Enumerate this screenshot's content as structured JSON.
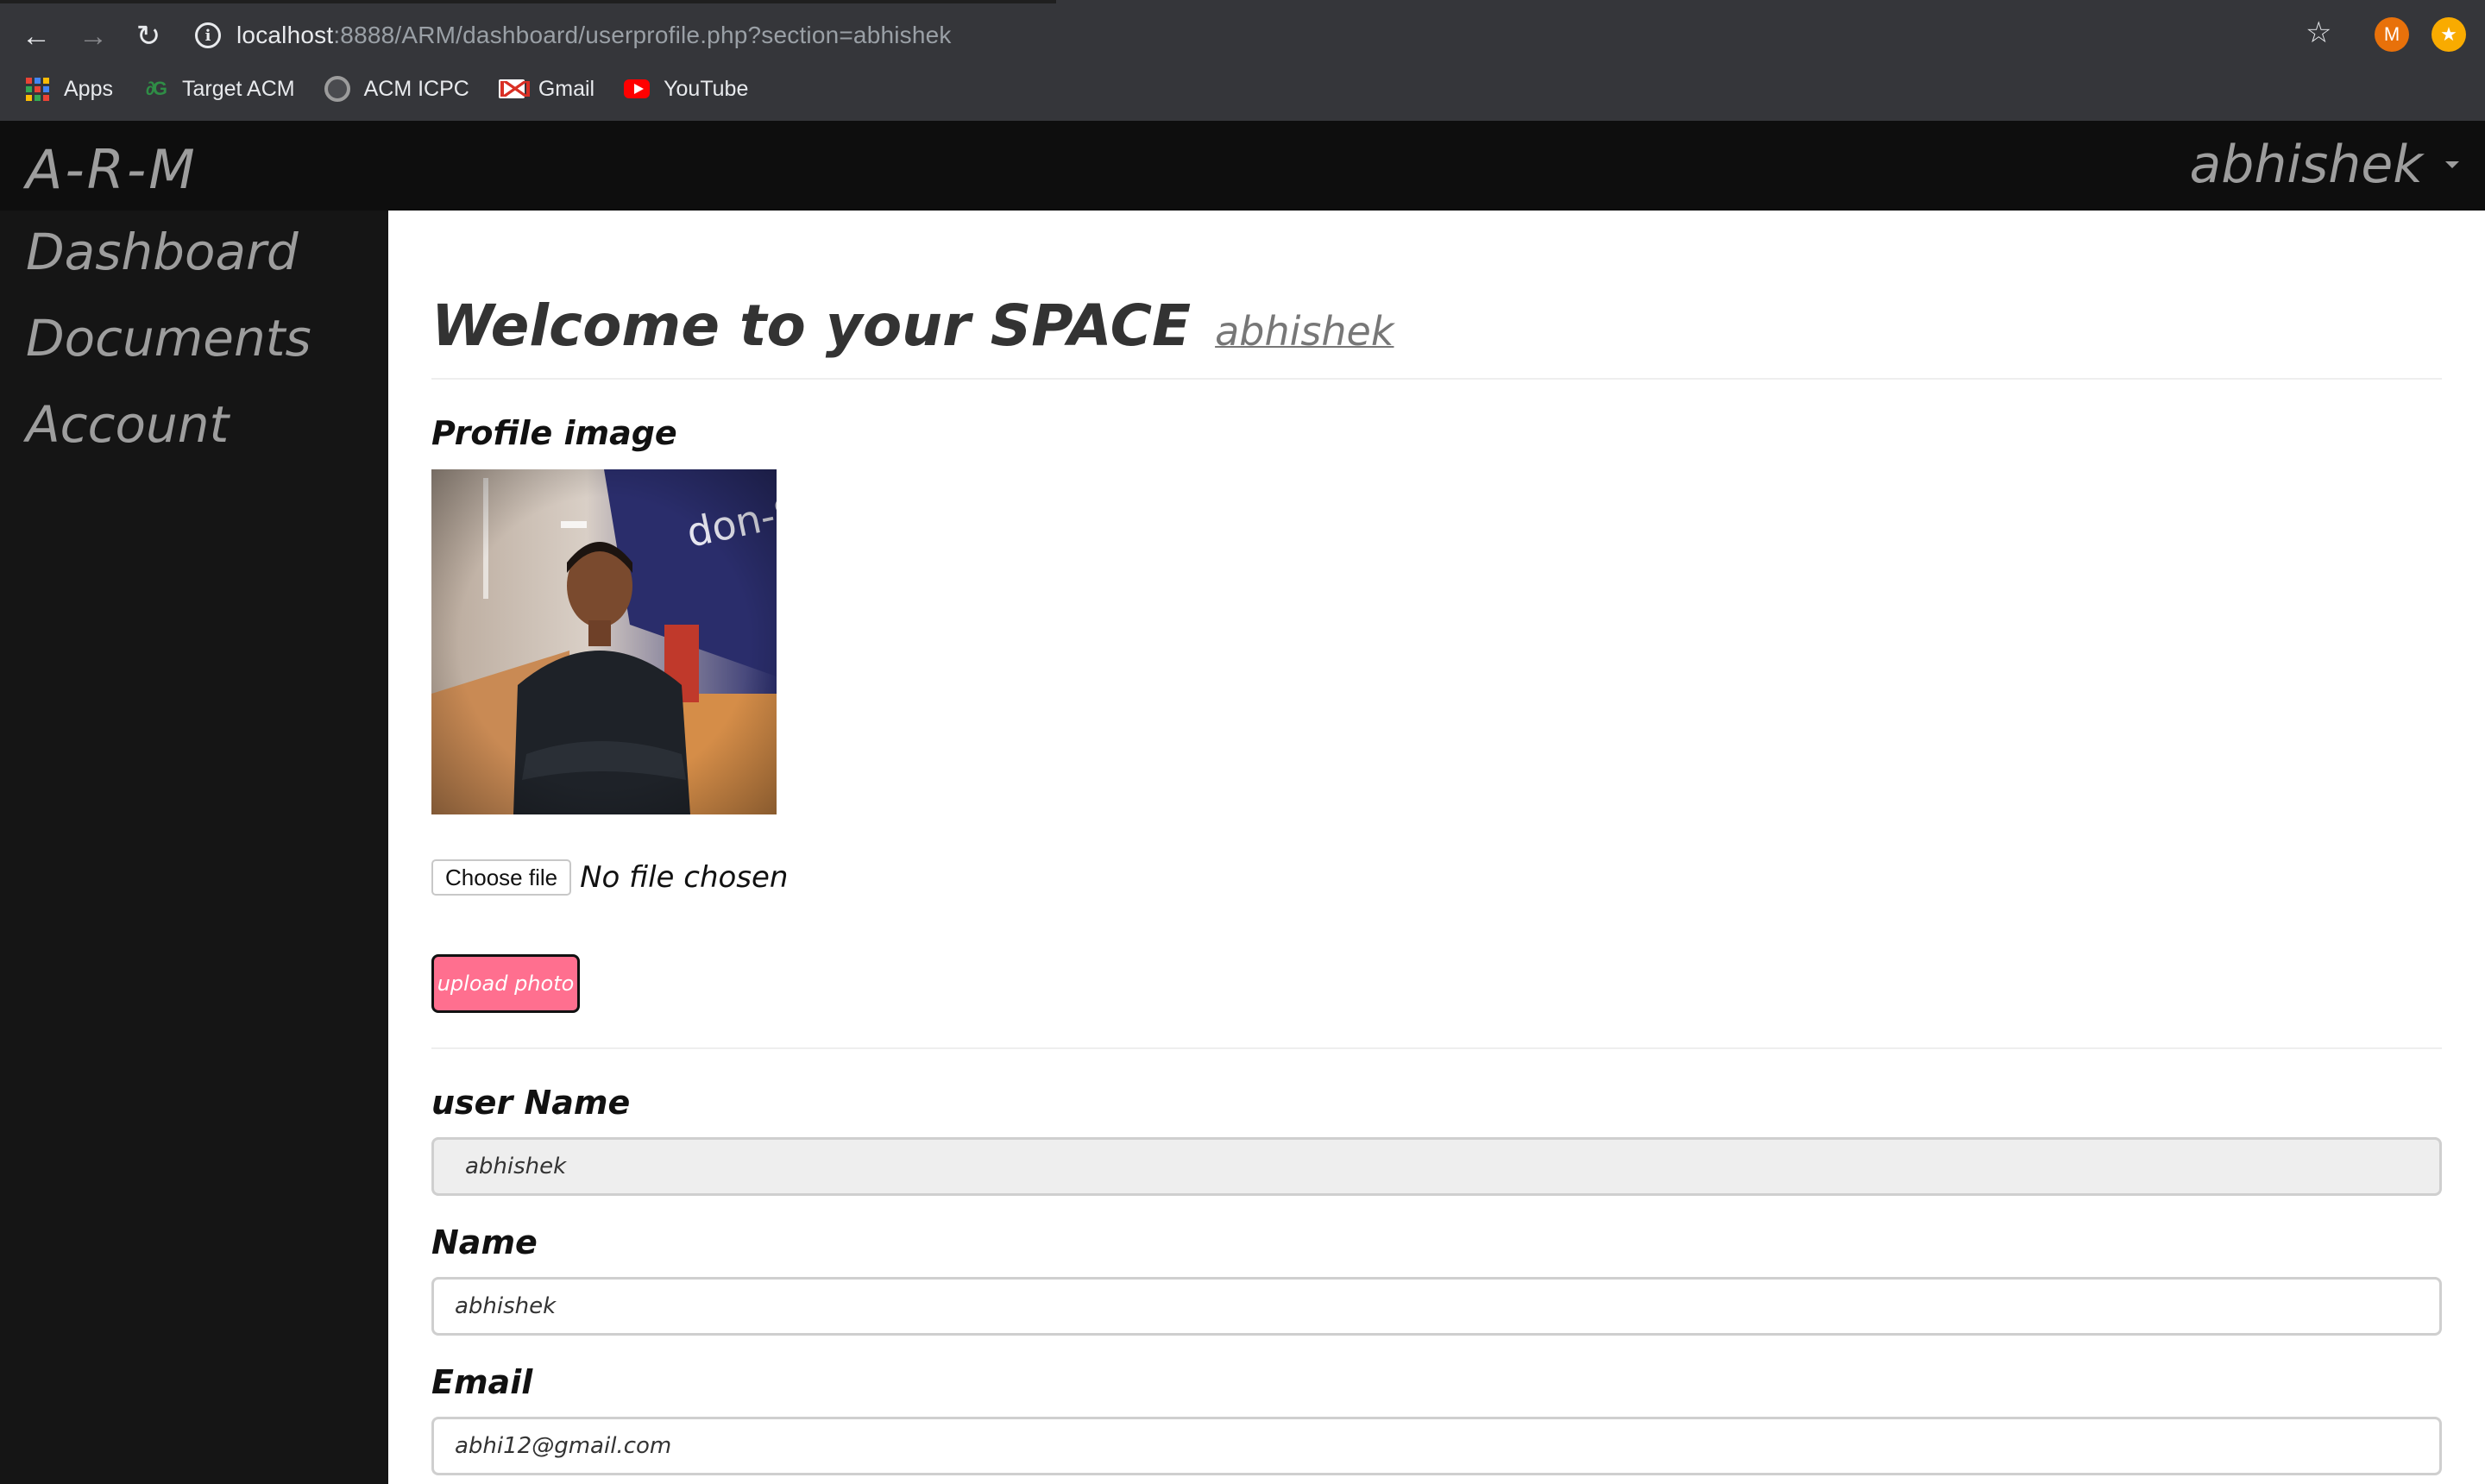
{
  "browser": {
    "url_host": "localhost",
    "url_rest": ":8888/ARM/dashboard/userprofile.php?section=abhishek",
    "profile_initial": "M",
    "bookmarks": [
      {
        "label": "Apps",
        "icon": "apps-grid-icon"
      },
      {
        "label": "Target ACM",
        "icon": "geeksforgeeks-icon"
      },
      {
        "label": "ACM ICPC",
        "icon": "github-icon"
      },
      {
        "label": "Gmail",
        "icon": "gmail-icon"
      },
      {
        "label": "YouTube",
        "icon": "youtube-icon"
      }
    ]
  },
  "app": {
    "brand": "A-R-M",
    "user": "abhishek"
  },
  "sidebar": {
    "items": [
      {
        "label": "Dashboard"
      },
      {
        "label": "Documents"
      },
      {
        "label": "Account"
      }
    ]
  },
  "main": {
    "title": "Welcome to your SPACE",
    "title_user": "abhishek",
    "profile_image_label": "Profile image",
    "choose_file_label": "Choose file",
    "file_status": "No file chosen",
    "upload_label": "upload photo",
    "fields": [
      {
        "label": "user Name",
        "value": "abhishek"
      },
      {
        "label": "Name",
        "value": "abhishek"
      },
      {
        "label": "Email",
        "value": "abhi12@gmail.com"
      }
    ]
  },
  "colors": {
    "navbar_bg": "#0e0e0e",
    "sidebar_bg": "#151515",
    "upload_button": "#ff6f8f",
    "chrome_bg": "#35363a"
  }
}
